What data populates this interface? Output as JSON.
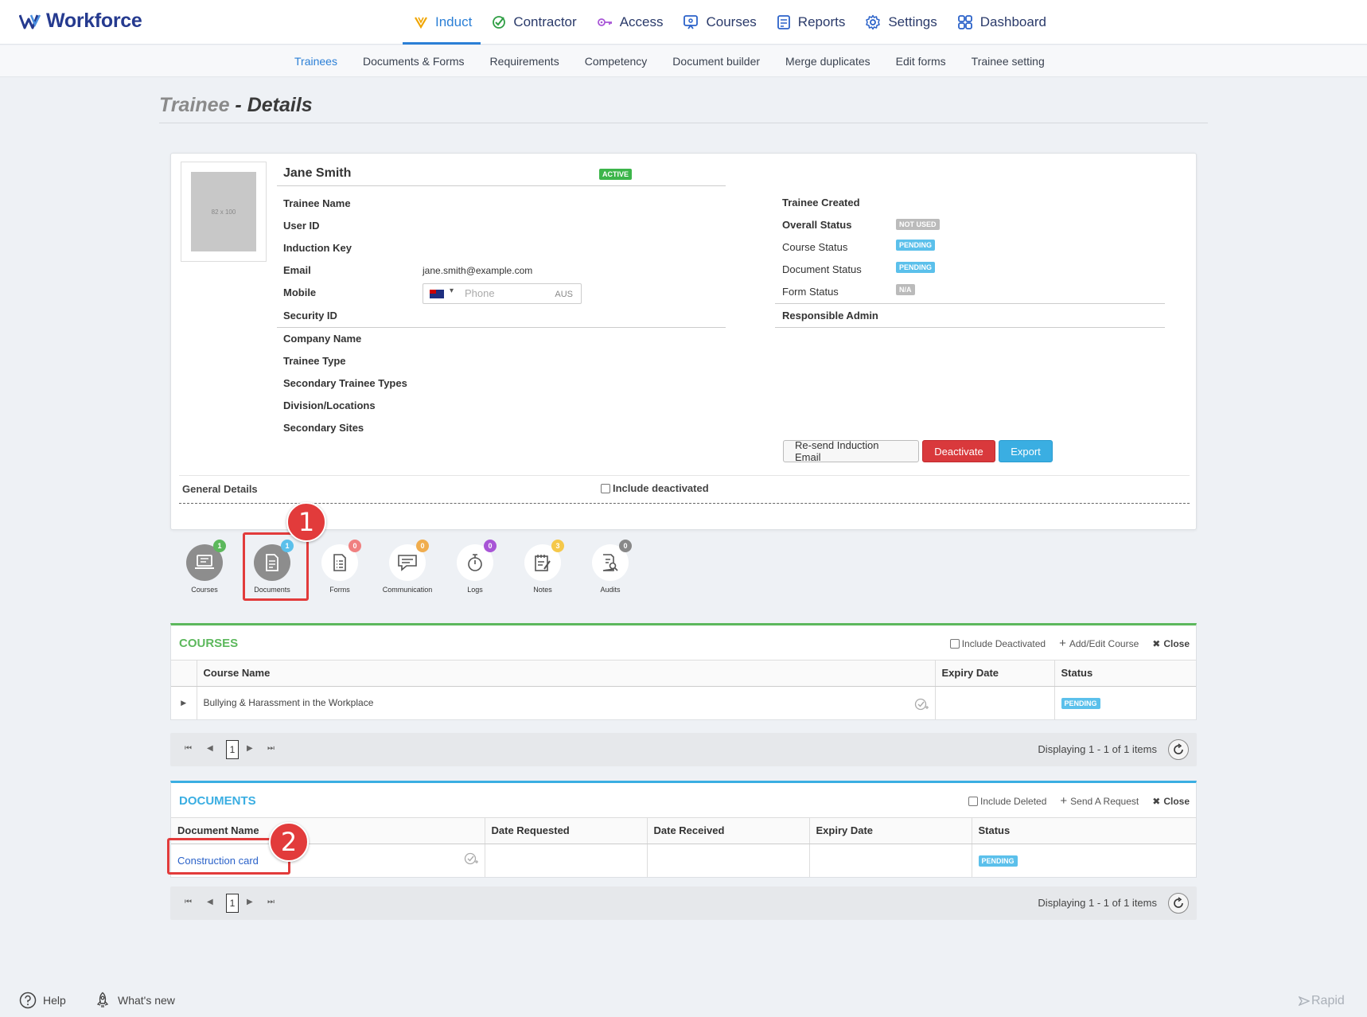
{
  "brand": {
    "name": "Workforce",
    "accent": "#253a8f"
  },
  "nav": {
    "items": [
      {
        "label": "Induct",
        "icon": "induct-icon",
        "active": true
      },
      {
        "label": "Contractor",
        "icon": "contractor-check-icon"
      },
      {
        "label": "Access",
        "icon": "key-icon"
      },
      {
        "label": "Courses",
        "icon": "courses-icon"
      },
      {
        "label": "Reports",
        "icon": "reports-icon"
      },
      {
        "label": "Settings",
        "icon": "gear-icon"
      },
      {
        "label": "Dashboard",
        "icon": "dashboard-grid-icon"
      }
    ]
  },
  "subnav": {
    "items": [
      {
        "label": "Trainees",
        "active": true
      },
      {
        "label": "Documents & Forms"
      },
      {
        "label": "Requirements"
      },
      {
        "label": "Competency"
      },
      {
        "label": "Document builder"
      },
      {
        "label": "Merge duplicates"
      },
      {
        "label": "Edit forms"
      },
      {
        "label": "Trainee setting"
      }
    ]
  },
  "page": {
    "title_prefix": "Trainee",
    "title_sep": " - ",
    "title_main": "Details"
  },
  "trainee": {
    "photo_placeholder": "82 x 100",
    "name": "Jane Smith",
    "status_badge": "ACTIVE",
    "fields": {
      "trainee_name": "Trainee Name",
      "user_id": "User ID",
      "induction_key": "Induction Key",
      "email": "Email",
      "mobile": "Mobile",
      "security_id": "Security ID",
      "company_name": "Company Name",
      "trainee_type": "Trainee Type",
      "secondary_trainee_types": "Secondary Trainee Types",
      "division_locations": "Division/Locations",
      "secondary_sites": "Secondary Sites"
    },
    "email_value": "jane.smith@example.com",
    "phone": {
      "placeholder": "Phone",
      "country": "AUS",
      "value": ""
    },
    "right": {
      "trainee_created": "Trainee Created",
      "overall_status": "Overall Status",
      "overall_status_value": "NOT USED",
      "course_status": "Course Status",
      "course_status_value": "PENDING",
      "document_status": "Document Status",
      "document_status_value": "PENDING",
      "form_status": "Form Status",
      "form_status_value": "N/A",
      "responsible_admin": "Responsible Admin"
    },
    "buttons": {
      "resend": "Re-send Induction Email",
      "deactivate": "Deactivate",
      "export": "Export"
    },
    "general_details": "General Details",
    "include_deactivated": "Include deactivated"
  },
  "tabs": [
    {
      "label": "Courses",
      "count": "1",
      "count_color": "#5cb85c",
      "icon": "courses-laptop-icon",
      "filled": true
    },
    {
      "label": "Documents",
      "count": "1",
      "count_color": "#5bc0eb",
      "icon": "document-icon",
      "filled": true
    },
    {
      "label": "Forms",
      "count": "0",
      "count_color": "#f08080",
      "icon": "forms-icon",
      "filled": false
    },
    {
      "label": "Communication",
      "count": "0",
      "count_color": "#f0ad4e",
      "icon": "chat-icon",
      "filled": false
    },
    {
      "label": "Logs",
      "count": "0",
      "count_color": "#a855d6",
      "icon": "stopwatch-icon",
      "filled": false
    },
    {
      "label": "Notes",
      "count": "3",
      "count_color": "#f5c84a",
      "icon": "notes-icon",
      "filled": false
    },
    {
      "label": "Audits",
      "count": "0",
      "count_color": "#888888",
      "icon": "audit-search-icon",
      "filled": false
    }
  ],
  "callouts": {
    "one": "1",
    "two": "2"
  },
  "courses_panel": {
    "title": "COURSES",
    "color": "#5cb85c",
    "include_deactivated": "Include Deactivated",
    "add_edit": "Add/Edit Course",
    "close": "Close",
    "columns": [
      "Course Name",
      "Expiry Date",
      "Status"
    ],
    "rows": [
      {
        "course_name": "Bullying & Harassment in the Workplace",
        "expiry": "",
        "status": "PENDING"
      }
    ],
    "pager": {
      "page": "1",
      "display": "Displaying 1 - 1 of 1 items"
    }
  },
  "documents_panel": {
    "title": "DOCUMENTS",
    "color": "#3aaee2",
    "include_deleted": "Include Deleted",
    "send_request": "Send A Request",
    "close": "Close",
    "columns": [
      "Document Name",
      "Date Requested",
      "Date Received",
      "Expiry Date",
      "Status"
    ],
    "rows": [
      {
        "name": "Construction card",
        "requested": "",
        "received": "",
        "expiry": "",
        "status": "PENDING"
      }
    ],
    "pager": {
      "page": "1",
      "display": "Displaying 1 - 1 of 1 items"
    }
  },
  "footer": {
    "help": "Help",
    "whats_new": "What's new",
    "rapid": "Rapid"
  }
}
